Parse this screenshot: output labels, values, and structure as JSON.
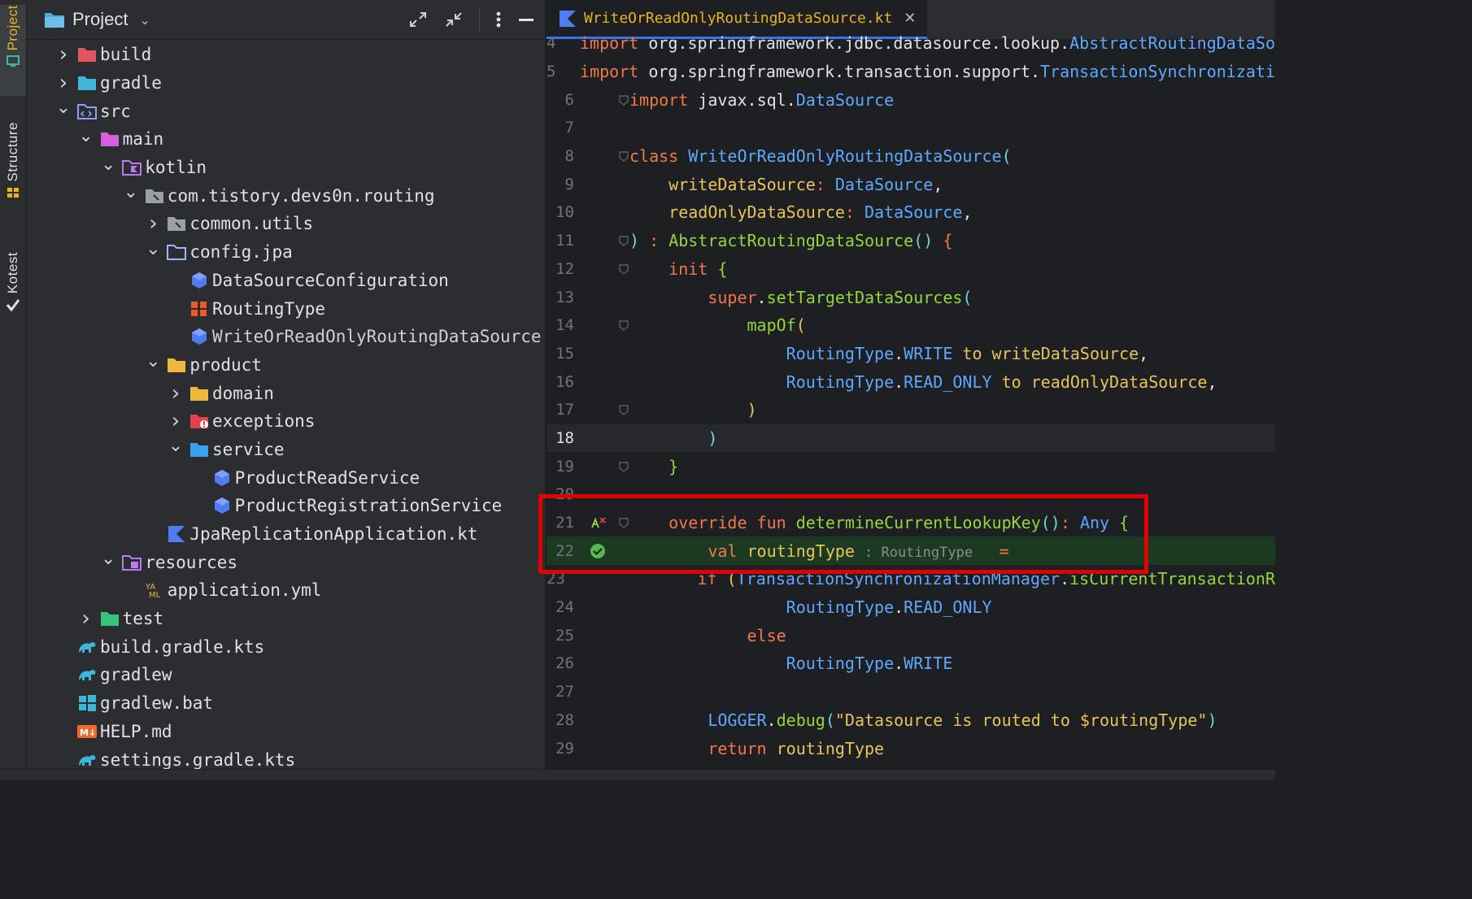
{
  "tool_stripe": {
    "project": "Project",
    "structure": "Structure",
    "kotest": "Kotest"
  },
  "panel": {
    "title": "Project"
  },
  "tree": [
    {
      "label": "build",
      "depth": 0,
      "chev": ">",
      "icon": "folder-excluded-icon",
      "color": "#e05561"
    },
    {
      "label": "gradle",
      "depth": 0,
      "chev": ">",
      "icon": "folder-gradle-icon",
      "color": "#3fb6d9"
    },
    {
      "label": "src",
      "depth": 0,
      "chev": "v",
      "icon": "folder-source-icon",
      "color": "#8aa0ff"
    },
    {
      "label": "main",
      "depth": 1,
      "chev": "v",
      "icon": "folder-icon",
      "color": "#d65fe0"
    },
    {
      "label": "kotlin",
      "depth": 2,
      "chev": "v",
      "icon": "folder-kotlin-icon",
      "color": "#b77cf2"
    },
    {
      "label": "com.tistory.devs0n.routing",
      "depth": 3,
      "chev": "v",
      "icon": "package-icon",
      "color": "#9aa0a8"
    },
    {
      "label": "common.utils",
      "depth": 4,
      "chev": ">",
      "icon": "package-icon",
      "color": "#9aa0a8"
    },
    {
      "label": "config.jpa",
      "depth": 4,
      "chev": "v",
      "icon": "folder-outline-icon",
      "color": "#9fb6ff"
    },
    {
      "label": "DataSourceConfiguration",
      "depth": 5,
      "chev": "",
      "icon": "class-icon",
      "color": "#4f7cf3"
    },
    {
      "label": "RoutingType",
      "depth": 5,
      "chev": "",
      "icon": "enum-icon",
      "color": "#f05a28"
    },
    {
      "label": "WriteOrReadOnlyRoutingDataSource",
      "depth": 5,
      "chev": "",
      "icon": "class-icon",
      "color": "#4f7cf3",
      "dim": true
    },
    {
      "label": "product",
      "depth": 4,
      "chev": "v",
      "icon": "folder-icon",
      "color": "#f0b73f"
    },
    {
      "label": "domain",
      "depth": 5,
      "chev": ">",
      "icon": "folder-icon",
      "color": "#f0b73f"
    },
    {
      "label": "exceptions",
      "depth": 5,
      "chev": ">",
      "icon": "folder-error-icon",
      "color": "#e0414b"
    },
    {
      "label": "service",
      "depth": 5,
      "chev": "v",
      "icon": "folder-service-icon",
      "color": "#3aa0f0"
    },
    {
      "label": "ProductReadService",
      "depth": 6,
      "chev": "",
      "icon": "class-icon",
      "color": "#4f7cf3"
    },
    {
      "label": "ProductRegistrationService",
      "depth": 6,
      "chev": "",
      "icon": "class-icon",
      "color": "#4f7cf3"
    },
    {
      "label": "JpaReplicationApplication.kt",
      "depth": 4,
      "chev": "",
      "icon": "kotlin-file-icon",
      "color": "#4f7cf3"
    },
    {
      "label": "resources",
      "depth": 2,
      "chev": "v",
      "icon": "folder-resources-icon",
      "color": "#b77cf2"
    },
    {
      "label": "application.yml",
      "depth": 3,
      "chev": "",
      "icon": "yaml-icon",
      "color": "#e8b34a"
    },
    {
      "label": "test",
      "depth": 1,
      "chev": ">",
      "icon": "folder-test-icon",
      "color": "#36c47b"
    },
    {
      "label": "build.gradle.kts",
      "depth": 0,
      "chev": "",
      "icon": "gradle-icon",
      "color": "#3fb6d9"
    },
    {
      "label": "gradlew",
      "depth": 0,
      "chev": "",
      "icon": "gradle-icon",
      "color": "#3fb6d9"
    },
    {
      "label": "gradlew.bat",
      "depth": 0,
      "chev": "",
      "icon": "windows-icon",
      "color": "#3fb6d9"
    },
    {
      "label": "HELP.md",
      "depth": 0,
      "chev": "",
      "icon": "markdown-icon",
      "color": "#f06a2b"
    },
    {
      "label": "settings.gradle.kts",
      "depth": 0,
      "chev": "",
      "icon": "gradle-icon",
      "color": "#3fb6d9"
    }
  ],
  "editor": {
    "tab_label": "WriteOrReadOnlyRoutingDataSource.kt",
    "current_line": 18
  },
  "code": [
    {
      "n": "4",
      "segs": [
        [
          "k",
          "import "
        ],
        [
          "w",
          "org"
        ],
        [
          "w",
          "."
        ],
        [
          "w",
          "springframework"
        ],
        [
          "w",
          "."
        ],
        [
          "w",
          "jdbc"
        ],
        [
          "w",
          "."
        ],
        [
          "w",
          "datasource"
        ],
        [
          "w",
          "."
        ],
        [
          "w",
          "lookup"
        ],
        [
          "w",
          "."
        ],
        [
          "t",
          "AbstractRoutingDataSo"
        ]
      ]
    },
    {
      "n": "5",
      "segs": [
        [
          "k",
          "import "
        ],
        [
          "w",
          "org"
        ],
        [
          "w",
          "."
        ],
        [
          "w",
          "springframework"
        ],
        [
          "w",
          "."
        ],
        [
          "w",
          "transaction"
        ],
        [
          "w",
          "."
        ],
        [
          "w",
          "support"
        ],
        [
          "w",
          "."
        ],
        [
          "t",
          "TransactionSynchronizati"
        ]
      ]
    },
    {
      "n": "6",
      "segs": [
        [
          "k",
          "import "
        ],
        [
          "w",
          "javax"
        ],
        [
          "w",
          "."
        ],
        [
          "w",
          "sql"
        ],
        [
          "w",
          "."
        ],
        [
          "t",
          "DataSource"
        ]
      ]
    },
    {
      "n": "7",
      "segs": []
    },
    {
      "n": "8",
      "segs": [
        [
          "k",
          "class "
        ],
        [
          "t",
          "WriteOrReadOnlyRoutingDataSource"
        ],
        [
          "c",
          "("
        ]
      ]
    },
    {
      "n": "9",
      "segs": [
        [
          "w",
          "    "
        ],
        [
          "p",
          "writeDataSource"
        ],
        [
          "k",
          ": "
        ],
        [
          "t",
          "DataSource"
        ],
        [
          "w",
          ","
        ]
      ]
    },
    {
      "n": "10",
      "segs": [
        [
          "w",
          "    "
        ],
        [
          "p",
          "readOnlyDataSource"
        ],
        [
          "k",
          ": "
        ],
        [
          "t",
          "DataSource"
        ],
        [
          "w",
          ","
        ]
      ]
    },
    {
      "n": "11",
      "segs": [
        [
          "c",
          ") "
        ],
        [
          "k",
          ": "
        ],
        [
          "f",
          "AbstractRoutingDataSource"
        ],
        [
          "c",
          "() "
        ],
        [
          "k",
          "{"
        ]
      ]
    },
    {
      "n": "12",
      "segs": [
        [
          "w",
          "    "
        ],
        [
          "k",
          "init "
        ],
        [
          "f",
          "{"
        ]
      ]
    },
    {
      "n": "13",
      "segs": [
        [
          "w",
          "        "
        ],
        [
          "k",
          "super"
        ],
        [
          "w",
          "."
        ],
        [
          "f",
          "setTargetDataSources"
        ],
        [
          "c",
          "("
        ]
      ]
    },
    {
      "n": "14",
      "segs": [
        [
          "w",
          "            "
        ],
        [
          "f",
          "mapOf"
        ],
        [
          "p",
          "("
        ]
      ]
    },
    {
      "n": "15",
      "segs": [
        [
          "w",
          "                "
        ],
        [
          "t",
          "RoutingType"
        ],
        [
          "w",
          "."
        ],
        [
          "t",
          "WRITE "
        ],
        [
          "p",
          "to "
        ],
        [
          "p",
          "writeDataSource"
        ],
        [
          "w",
          ","
        ]
      ]
    },
    {
      "n": "16",
      "segs": [
        [
          "w",
          "                "
        ],
        [
          "t",
          "RoutingType"
        ],
        [
          "w",
          "."
        ],
        [
          "t",
          "READ_ONLY "
        ],
        [
          "p",
          "to "
        ],
        [
          "p",
          "readOnlyDataSource"
        ],
        [
          "w",
          ","
        ]
      ]
    },
    {
      "n": "17",
      "segs": [
        [
          "w",
          "            "
        ],
        [
          "p",
          ")"
        ]
      ]
    },
    {
      "n": "18",
      "segs": [
        [
          "w",
          "        "
        ],
        [
          "c",
          ")"
        ]
      ]
    },
    {
      "n": "19",
      "segs": [
        [
          "w",
          "    "
        ],
        [
          "f",
          "}"
        ]
      ]
    },
    {
      "n": "20",
      "segs": []
    },
    {
      "n": "21",
      "segs": [
        [
          "w",
          "    "
        ],
        [
          "k",
          "override fun "
        ],
        [
          "f",
          "determineCurrentLookupKey"
        ],
        [
          "c",
          "()"
        ],
        [
          "k",
          ": "
        ],
        [
          "t",
          "Any "
        ],
        [
          "f",
          "{"
        ]
      ]
    },
    {
      "n": "22",
      "segs": [
        [
          "w",
          "        "
        ],
        [
          "k",
          "val "
        ],
        [
          "p",
          "routingType "
        ],
        [
          "hint",
          ": RoutingType  "
        ],
        [
          "k",
          " ="
        ]
      ]
    },
    {
      "n": "23",
      "segs": [
        [
          "w",
          "            "
        ],
        [
          "k",
          "if "
        ],
        [
          "p",
          "("
        ],
        [
          "t",
          "TransactionSynchronizationManager"
        ],
        [
          "w",
          "."
        ],
        [
          "f",
          "isCurrentTransactionR"
        ]
      ]
    },
    {
      "n": "24",
      "segs": [
        [
          "w",
          "                "
        ],
        [
          "t",
          "RoutingType"
        ],
        [
          "w",
          "."
        ],
        [
          "t",
          "READ_ONLY"
        ]
      ]
    },
    {
      "n": "25",
      "segs": [
        [
          "w",
          "            "
        ],
        [
          "k",
          "else"
        ]
      ]
    },
    {
      "n": "26",
      "segs": [
        [
          "w",
          "                "
        ],
        [
          "t",
          "RoutingType"
        ],
        [
          "w",
          "."
        ],
        [
          "t",
          "WRITE"
        ]
      ]
    },
    {
      "n": "27",
      "segs": []
    },
    {
      "n": "28",
      "segs": [
        [
          "w",
          "        "
        ],
        [
          "t",
          "LOGGER"
        ],
        [
          "w",
          "."
        ],
        [
          "f",
          "debug"
        ],
        [
          "c",
          "("
        ],
        [
          "p",
          "\"Datasource is routed to $routingType\""
        ],
        [
          "c",
          ")"
        ]
      ]
    },
    {
      "n": "29",
      "segs": [
        [
          "w",
          "        "
        ],
        [
          "k",
          "return "
        ],
        [
          "p",
          "routingType"
        ]
      ]
    }
  ]
}
